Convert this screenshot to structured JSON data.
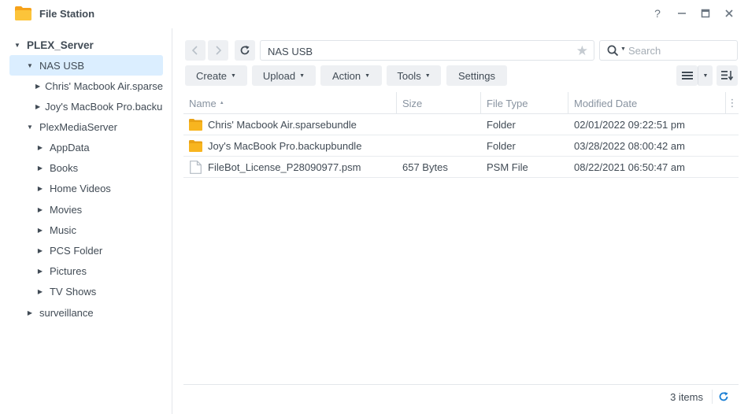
{
  "window": {
    "title": "File Station",
    "controls": {
      "help": "?",
      "minimize": "—",
      "maximize": "□",
      "close": "✕"
    }
  },
  "sidebar": {
    "items": [
      {
        "label": "PLEX_Server",
        "level": 0,
        "expanded": true
      },
      {
        "label": "NAS USB",
        "level": 1,
        "expanded": true,
        "selected": true
      },
      {
        "label": "Chris' Macbook Air.sparsebundle",
        "level": 2,
        "expanded": false
      },
      {
        "label": "Joy's MacBook Pro.backupbundle",
        "level": 2,
        "expanded": false
      },
      {
        "label": "PlexMediaServer",
        "level": 1,
        "expanded": true
      },
      {
        "label": "AppData",
        "level": 2,
        "expanded": false
      },
      {
        "label": "Books",
        "level": 2,
        "expanded": false
      },
      {
        "label": "Home Videos",
        "level": 2,
        "expanded": false
      },
      {
        "label": "Movies",
        "level": 2,
        "expanded": false
      },
      {
        "label": "Music",
        "level": 2,
        "expanded": false
      },
      {
        "label": "PCS Folder",
        "level": 2,
        "expanded": false
      },
      {
        "label": "Pictures",
        "level": 2,
        "expanded": false
      },
      {
        "label": "TV Shows",
        "level": 2,
        "expanded": false
      },
      {
        "label": "surveillance",
        "level": 1,
        "expanded": false
      }
    ]
  },
  "toolbar": {
    "path": "NAS USB",
    "search_placeholder": "Search",
    "buttons": {
      "create": "Create",
      "upload": "Upload",
      "action": "Action",
      "tools": "Tools",
      "settings": "Settings"
    }
  },
  "file_list": {
    "columns": {
      "name": "Name",
      "name_sort": "▲",
      "size": "Size",
      "type": "File Type",
      "modified": "Modified Date",
      "more": "⋮"
    },
    "rows": [
      {
        "icon": "folder-icon",
        "name": "Chris' Macbook Air.sparsebundle",
        "size": "",
        "type": "Folder",
        "modified": "02/01/2022 09:22:51 pm"
      },
      {
        "icon": "folder-icon",
        "name": "Joy's MacBook Pro.backupbundle",
        "size": "",
        "type": "Folder",
        "modified": "03/28/2022 08:00:42 am"
      },
      {
        "icon": "file-icon",
        "name": "FileBot_License_P28090977.psm",
        "size": "657 Bytes",
        "type": "PSM File",
        "modified": "08/22/2021 06:50:47 am"
      }
    ]
  },
  "footer": {
    "count": "3 items"
  },
  "colors": {
    "accent": "#1a7fd4",
    "folder": "#f8b51f",
    "selected_bg": "#dbeeff",
    "button_bg": "#eef0f3"
  }
}
